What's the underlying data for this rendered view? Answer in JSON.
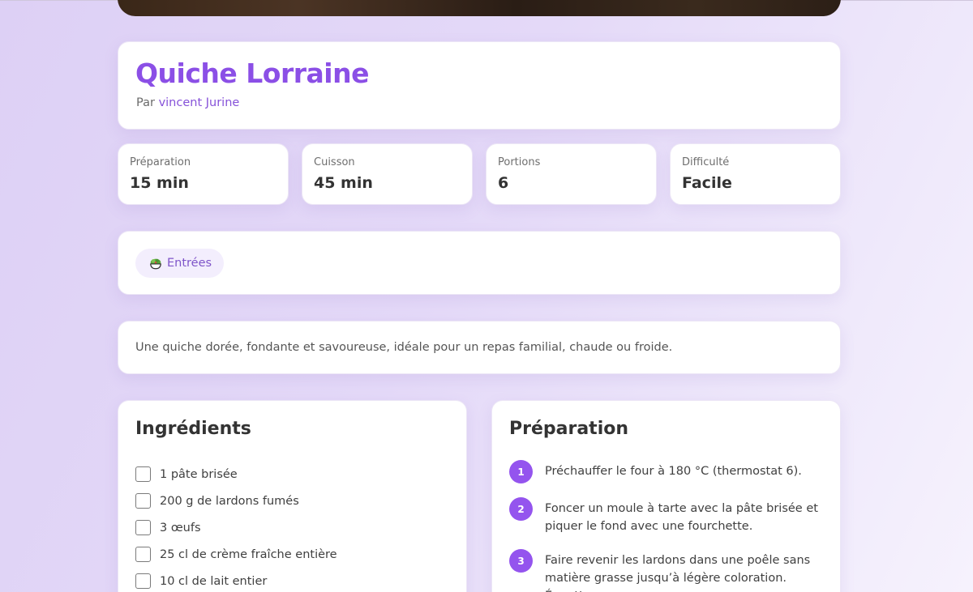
{
  "recipe": {
    "title": "Quiche Lorraine",
    "byline_prefix": "Par",
    "author": "vincent Jurine",
    "description": "Une quiche dorée, fondante et savoureuse, idéale pour un repas familial, chaude ou froide."
  },
  "stats": [
    {
      "label": "Préparation",
      "value": "15 min"
    },
    {
      "label": "Cuisson",
      "value": "45 min"
    },
    {
      "label": "Portions",
      "value": "6"
    },
    {
      "label": "Difficulté",
      "value": "Facile"
    }
  ],
  "category": {
    "icon": "salad-bowl-icon",
    "label": "Entrées"
  },
  "ingredients": {
    "title": "Ingrédients",
    "items": [
      "1 pâte brisée",
      "200 g de lardons fumés",
      "3 œufs",
      "25 cl de crème fraîche entière",
      "10 cl de lait entier"
    ]
  },
  "preparation": {
    "title": "Préparation",
    "steps": [
      {
        "number": "1",
        "text": "Préchauffer le four à 180 °C (thermostat 6)."
      },
      {
        "number": "2",
        "text": "Foncer un moule à tarte avec la pâte brisée et piquer le fond avec une fourchette."
      },
      {
        "number": "3",
        "text": "Faire revenir les lardons dans une poêle sans matière grasse jusqu’à légère coloration. Égoutter."
      }
    ]
  },
  "colors": {
    "accent": "#8b4fe6",
    "step_badge": "#9454ee",
    "tag_bg": "#f3eefd"
  }
}
